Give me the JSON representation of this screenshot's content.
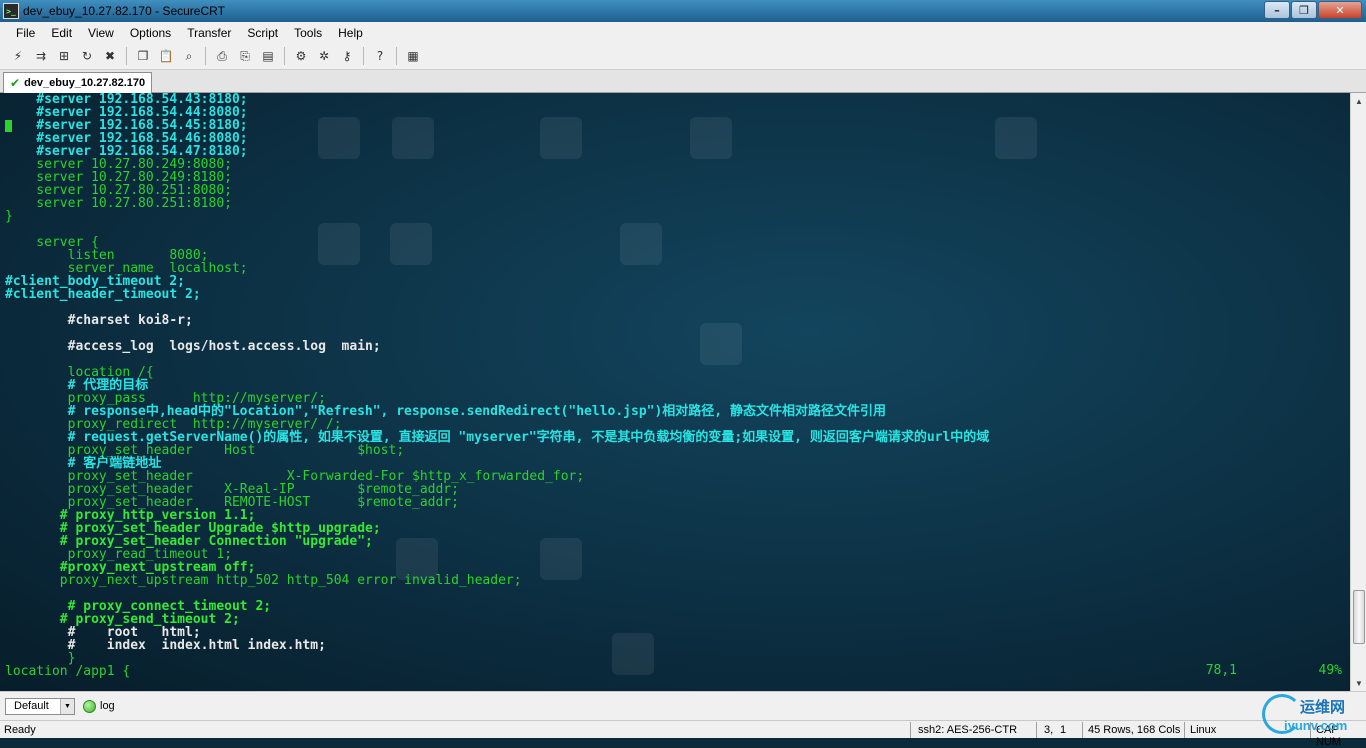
{
  "window": {
    "title": "dev_ebuy_10.27.82.170 - SecureCRT",
    "minimize_glyph": "–",
    "maximize_glyph": "❐",
    "close_glyph": "✕"
  },
  "menu": [
    "File",
    "Edit",
    "View",
    "Options",
    "Transfer",
    "Script",
    "Tools",
    "Help"
  ],
  "toolbar_icons": [
    "connect-icon",
    "quick-connect-icon",
    "connect-tab-icon",
    "reconnect-icon",
    "disconnect-icon",
    "copy-icon",
    "paste-icon",
    "find-icon",
    "print-icon",
    "print-selection-icon",
    "print-setup-icon",
    "session-options-icon",
    "global-options-icon",
    "keymap-icon",
    "help-icon",
    "sftp-icon"
  ],
  "tab": {
    "label": "dev_ebuy_10.27.82.170",
    "status_icon": "check-icon"
  },
  "terminal": {
    "lines": [
      {
        "t": "    #server 192.168.54.43:8180;",
        "s": "c"
      },
      {
        "t": "    #server 192.168.54.44:8080;",
        "s": "c"
      },
      {
        "t": "    #server 192.168.54.45:8180;",
        "s": "c"
      },
      {
        "t": "    #server 192.168.54.46:8080;",
        "s": "c"
      },
      {
        "t": "    #server 192.168.54.47:8180;",
        "s": "c"
      },
      {
        "t": "    server 10.27.80.249:8080;",
        "s": "g"
      },
      {
        "t": "    server 10.27.80.249:8180;",
        "s": "g"
      },
      {
        "t": "    server 10.27.80.251:8080;",
        "s": "g"
      },
      {
        "t": "    server 10.27.80.251:8180;",
        "s": "g"
      },
      {
        "t": "}",
        "s": "g"
      },
      {
        "t": "",
        "s": "g"
      },
      {
        "t": "    server {",
        "s": "g"
      },
      {
        "t": "        listen       8080;",
        "s": "g"
      },
      {
        "t": "        server_name  localhost;",
        "s": "g"
      },
      {
        "t": "#client_body_timeout 2;",
        "s": "c"
      },
      {
        "t": "#client_header_timeout 2;",
        "s": "c"
      },
      {
        "t": "",
        "s": "g"
      },
      {
        "t": "        #charset koi8-r;",
        "s": "w"
      },
      {
        "t": "",
        "s": "g"
      },
      {
        "t": "        #access_log  logs/host.access.log  main;",
        "s": "w"
      },
      {
        "t": "",
        "s": "g"
      },
      {
        "t": "        location /{",
        "s": "g"
      },
      {
        "t": "        # 代理的目标",
        "s": "c"
      },
      {
        "t": "        proxy_pass      http://myserver/;",
        "s": "g"
      },
      {
        "t": "        # response中,head中的\"Location\",\"Refresh\", response.sendRedirect(\"hello.jsp\")相对路径, 静态文件相对路径文件引用",
        "s": "c"
      },
      {
        "t": "        proxy_redirect  http://myserver/ /;",
        "s": "g"
      },
      {
        "t": "        # request.getServerName()的属性, 如果不设置, 直接返回 \"myserver\"字符串, 不是其中负载均衡的变量;如果设置, 则返回客户端请求的url中的域",
        "s": "c"
      },
      {
        "t": "        proxy_set_header    Host             $host;",
        "s": "g"
      },
      {
        "t": "        # 客户端链地址",
        "s": "c"
      },
      {
        "t": "        proxy_set_header            X-Forwarded-For $http_x_forwarded_for;",
        "s": "g"
      },
      {
        "t": "        proxy_set_header    X-Real-IP        $remote_addr;",
        "s": "g"
      },
      {
        "t": "        proxy_set_header    REMOTE-HOST      $remote_addr;",
        "s": "g"
      },
      {
        "t": "       # proxy_http_version 1.1;",
        "s": "gb"
      },
      {
        "t": "       # proxy_set_header Upgrade $http_upgrade;",
        "s": "gb"
      },
      {
        "t": "       # proxy_set_header Connection \"upgrade\";",
        "s": "gb"
      },
      {
        "t": "        proxy_read_timeout 1;",
        "s": "g"
      },
      {
        "t": "       #proxy_next_upstream off;",
        "s": "gb"
      },
      {
        "t": "       proxy_next_upstream http_502 http_504 error invalid_header;",
        "s": "g"
      },
      {
        "t": "",
        "s": "g"
      },
      {
        "t": "        # proxy_connect_timeout 2;",
        "s": "gb"
      },
      {
        "t": "       # proxy_send_timeout 2;",
        "s": "gb"
      },
      {
        "t": "        #    root   html;",
        "s": "w"
      },
      {
        "t": "        #    index  index.html index.htm;",
        "s": "w"
      },
      {
        "t": "        }",
        "s": "g"
      },
      {
        "t": "location /app1 {",
        "s": "g"
      }
    ],
    "cursor_position": "78,1",
    "scroll_percent": "49%"
  },
  "command_bar": {
    "session_combo": "Default",
    "log_label": "log"
  },
  "status_bar": {
    "ready": "Ready",
    "cipher": "ssh2: AES-256-CTR",
    "cursor_row": "3,",
    "cursor_col": "1",
    "size": "45 Rows, 168 Cols",
    "os": "Linux",
    "keys": "CAP  NUM"
  },
  "watermark": {
    "cn": "运维网",
    "en": "iyunv.com"
  }
}
